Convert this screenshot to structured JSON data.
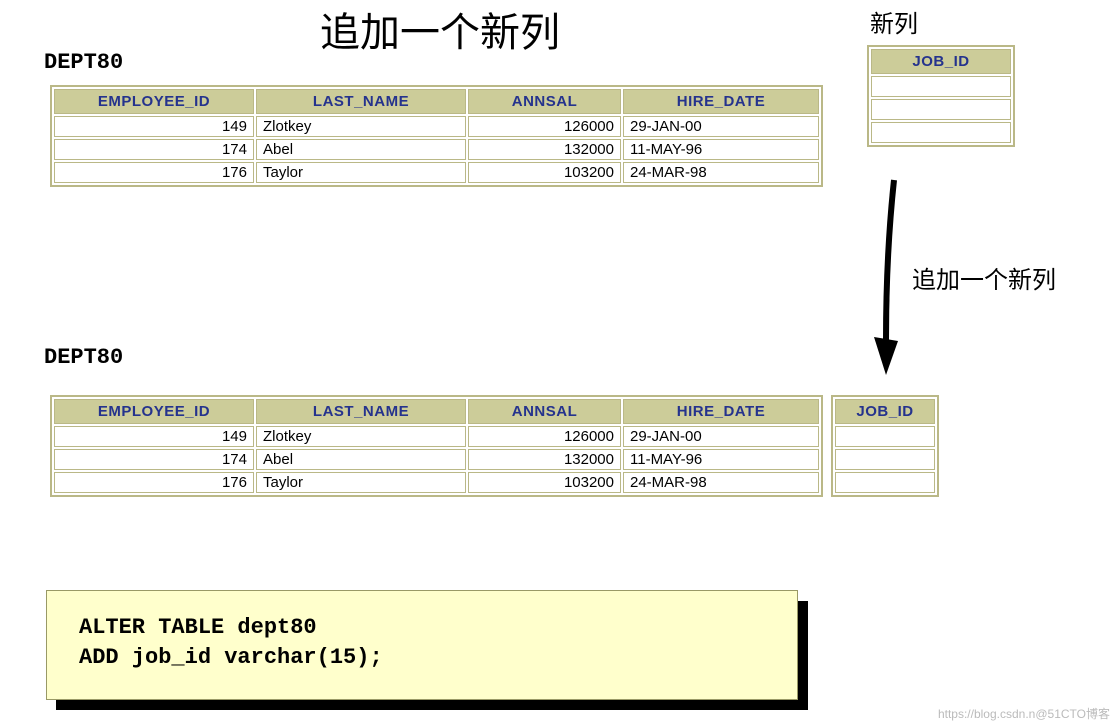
{
  "title": "追加一个新列",
  "topright_label": "新列",
  "dept_label_1": "DEPT80",
  "dept_label_2": "DEPT80",
  "arrow_label": "追加一个新列",
  "sql": "ALTER TABLE dept80\nADD job_id varchar(15);",
  "main_table": {
    "columns": [
      "EMPLOYEE_ID",
      "LAST_NAME",
      "ANNSAL",
      "HIRE_DATE"
    ],
    "rows": [
      {
        "employee_id": "149",
        "last_name": "Zlotkey",
        "annsal": "126000",
        "hire_date": "29-JAN-00"
      },
      {
        "employee_id": "174",
        "last_name": "Abel",
        "annsal": "132000",
        "hire_date": "11-MAY-96"
      },
      {
        "employee_id": "176",
        "last_name": "Taylor",
        "annsal": "103200",
        "hire_date": "24-MAR-98"
      }
    ]
  },
  "jobid_table": {
    "column": "JOB_ID",
    "rows": [
      "",
      "",
      ""
    ]
  },
  "watermark": "https://blog.csdn.n@51CTO博客"
}
